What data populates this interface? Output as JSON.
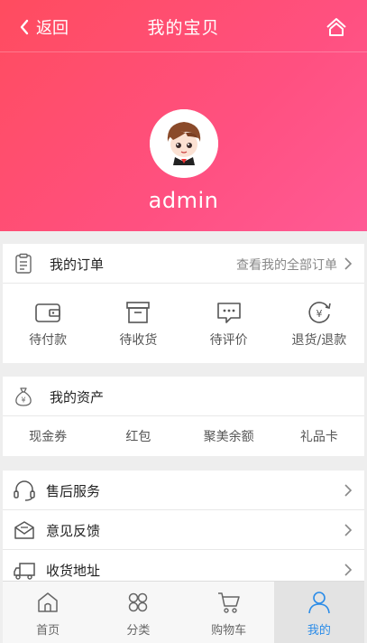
{
  "header": {
    "back_label": "返回",
    "title": "我的宝贝",
    "username": "admin"
  },
  "orders": {
    "title": "我的订单",
    "view_all": "查看我的全部订单",
    "items": [
      {
        "label": "待付款",
        "icon": "wallet-icon"
      },
      {
        "label": "待收货",
        "icon": "box-icon"
      },
      {
        "label": "待评价",
        "icon": "comment-icon"
      },
      {
        "label": "退货/退款",
        "icon": "refund-icon"
      }
    ]
  },
  "assets": {
    "title": "我的资产",
    "items": [
      "现金券",
      "红包",
      "聚美余额",
      "礼品卡"
    ]
  },
  "services": [
    {
      "label": "售后服务",
      "icon": "headset-icon"
    },
    {
      "label": "意见反馈",
      "icon": "feedback-icon"
    },
    {
      "label": "收货地址",
      "icon": "truck-icon"
    }
  ],
  "tabs": [
    {
      "label": "首页",
      "icon": "home-icon",
      "active": false
    },
    {
      "label": "分类",
      "icon": "category-icon",
      "active": false
    },
    {
      "label": "购物车",
      "icon": "cart-icon",
      "active": false
    },
    {
      "label": "我的",
      "icon": "user-icon",
      "active": true
    }
  ],
  "colors": {
    "brand_gradient_start": "#ff4c5f",
    "brand_gradient_end": "#ff5a95",
    "active_tab": "#2b8ce8"
  }
}
